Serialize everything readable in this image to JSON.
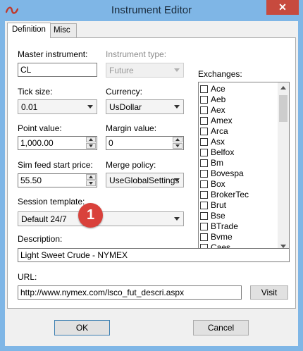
{
  "window": {
    "title": "Instrument Editor",
    "close_glyph": "✕",
    "app_icon": "ninja-logo-icon"
  },
  "tabs": [
    {
      "label": "Definition",
      "active": true
    },
    {
      "label": "Misc",
      "active": false
    }
  ],
  "fields": {
    "master_instrument": {
      "label": "Master instrument:",
      "value": "CL"
    },
    "instrument_type": {
      "label": "Instrument type:",
      "value": "Future",
      "disabled": true
    },
    "tick_size": {
      "label": "Tick size:",
      "value": "0.01"
    },
    "currency": {
      "label": "Currency:",
      "value": "UsDollar"
    },
    "point_value": {
      "label": "Point value:",
      "value": "1,000.00"
    },
    "margin_value": {
      "label": "Margin value:",
      "value": "0"
    },
    "sim_feed_start_price": {
      "label": "Sim feed start price:",
      "value": "55.50"
    },
    "merge_policy": {
      "label": "Merge policy:",
      "value": "UseGlobalSettings"
    },
    "session_template": {
      "label": "Session template:",
      "value": "Default 24/7"
    },
    "description": {
      "label": "Description:",
      "value": "Light Sweet Crude - NYMEX"
    },
    "url": {
      "label": "URL:",
      "value": "http://www.nymex.com/lsco_fut_descri.aspx"
    }
  },
  "exchanges": {
    "label": "Exchanges:",
    "items": [
      "Ace",
      "Aeb",
      "Aex",
      "Amex",
      "Arca",
      "Asx",
      "Belfox",
      "Bm",
      "Bovespa",
      "Box",
      "BrokerTec",
      "Brut",
      "Bse",
      "BTrade",
      "Bvme",
      "Caes"
    ]
  },
  "buttons": {
    "visit": "Visit",
    "ok": "OK",
    "cancel": "Cancel"
  },
  "annotation_badge": "1",
  "colors": {
    "titlebar": "#7fb6e6",
    "close_button": "#c74a3e",
    "badge": "#d9413b"
  }
}
